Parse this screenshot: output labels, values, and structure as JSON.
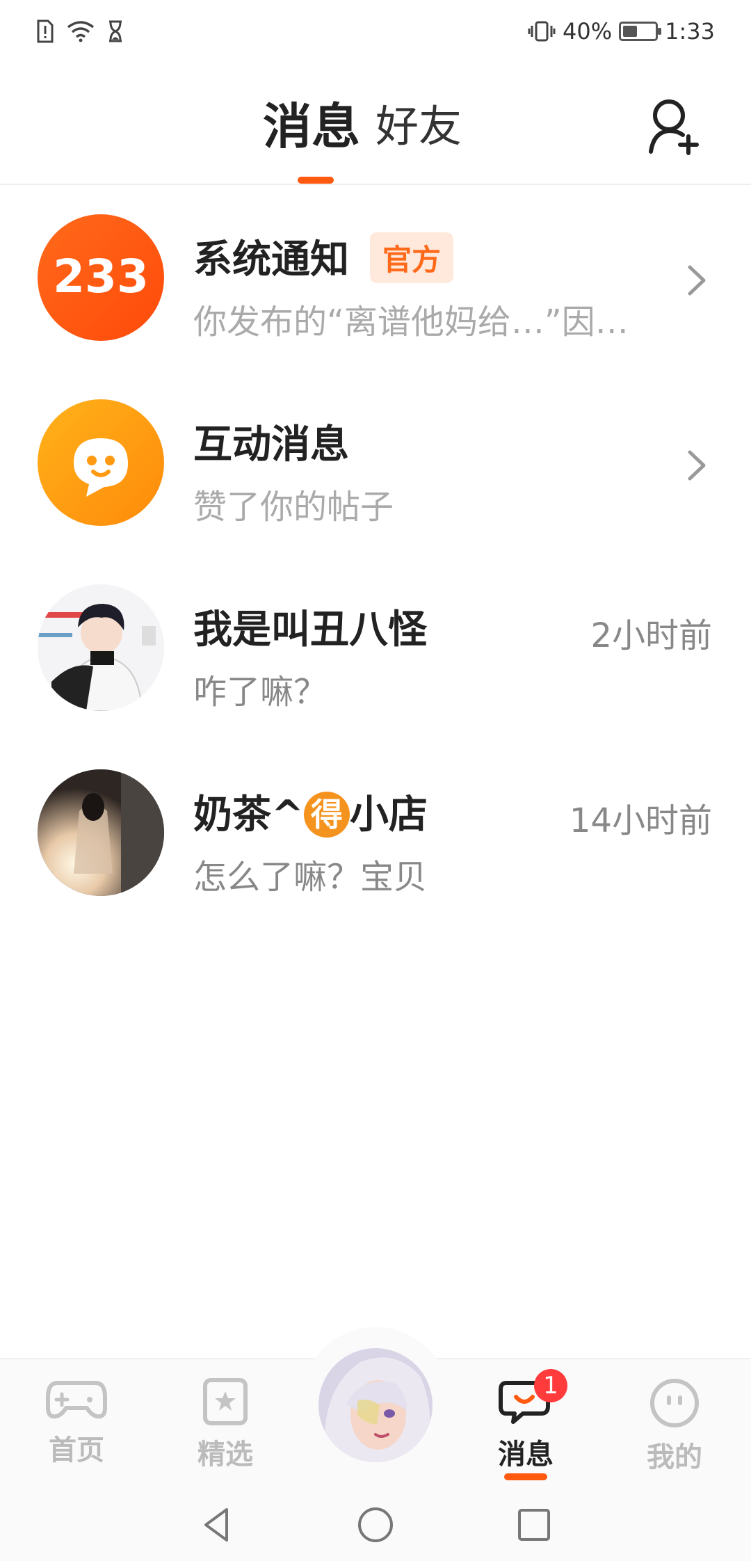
{
  "status_bar": {
    "battery_percent": "40%",
    "battery_level": 0.4,
    "time": "1:33",
    "icons": [
      "sim-alert-icon",
      "wifi-icon",
      "hourglass-icon",
      "vibrate-icon",
      "battery-icon"
    ]
  },
  "header": {
    "tab_messages": "消息",
    "tab_friends": "好友",
    "add_friend_icon": "add-user-icon"
  },
  "conversations": [
    {
      "title": "系统通知",
      "badge": "官方",
      "subtitle": "你发布的“离谱他妈给…”因…",
      "avatar_text": "233"
    },
    {
      "title": "互动消息",
      "subtitle": "赞了你的帖子"
    },
    {
      "title": "我是叫丑八怪",
      "subtitle": "咋了嘛？",
      "time": "2小时前"
    },
    {
      "title_prefix": "奶茶^",
      "title_char": "得",
      "title_suffix": "小店",
      "subtitle": "怎么了嘛？宝贝",
      "time": "14小时前"
    }
  ],
  "bottom_nav": {
    "home": "首页",
    "featured": "精选",
    "messages": "消息",
    "mine": "我的",
    "message_badge": "1"
  },
  "colors": {
    "accent": "#ff5a10",
    "official_badge_bg": "#ffe9dc",
    "official_badge_text": "#ff6a1a",
    "badge_red": "#ff3b3b"
  }
}
